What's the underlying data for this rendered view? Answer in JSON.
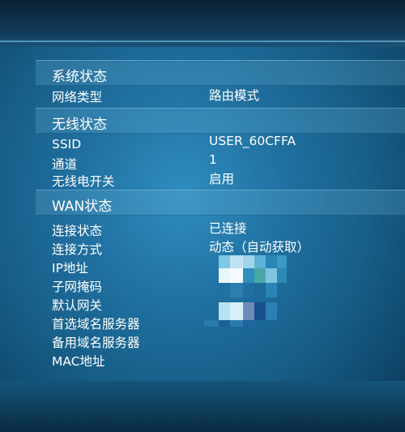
{
  "sections": {
    "system": {
      "title": "系统状态",
      "rows": [
        {
          "label": "网络类型",
          "value": "路由模式"
        }
      ]
    },
    "wireless": {
      "title": "无线状态",
      "rows": [
        {
          "label": "SSID",
          "value": "USER_60CFFA"
        },
        {
          "label": "通道",
          "value": "1"
        },
        {
          "label": "无线电开关",
          "value": "启用"
        }
      ]
    },
    "wan": {
      "title": "WAN状态",
      "rows": [
        {
          "label": "连接状态",
          "value": "已连接"
        },
        {
          "label": "连接方式",
          "value": "动态（自动获取）"
        },
        {
          "label": "IP地址",
          "value": ""
        },
        {
          "label": "子网掩码",
          "value": ""
        },
        {
          "label": "默认网关",
          "value": ""
        },
        {
          "label": "首选域名服务器",
          "value": ""
        },
        {
          "label": "备用域名服务器",
          "value": ""
        },
        {
          "label": "MAC地址",
          "value": ""
        }
      ]
    }
  },
  "colors": {
    "background": "#1f6f9f",
    "header": "#4c9cc6",
    "text": "#ffffff"
  }
}
